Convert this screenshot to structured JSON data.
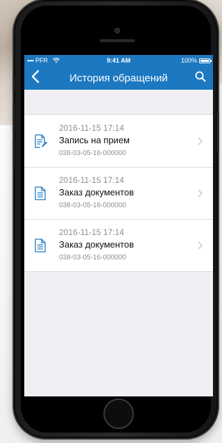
{
  "status_bar": {
    "carrier": "PFR",
    "signal": "•••••",
    "time": "9:41 AM",
    "battery": "100%"
  },
  "nav": {
    "title": "История обращений",
    "back_icon": "chevron-left-icon",
    "search_icon": "search-icon"
  },
  "requests": [
    {
      "date": "2016-11-15 17:14",
      "title": "Запись на прием",
      "number": "038-03-05-16-000000",
      "icon": "document-edit-icon"
    },
    {
      "date": "2016-11-15 17:14",
      "title": "Заказ документов",
      "number": "038-03-05-16-000000",
      "icon": "document-icon"
    },
    {
      "date": "2016-11-15 17:14",
      "title": "Заказ документов",
      "number": "038-03-05-16-000000",
      "icon": "document-icon"
    }
  ],
  "colors": {
    "accent": "#1c78c0",
    "background": "#efeff4",
    "secondary_text": "#8e8e93"
  }
}
